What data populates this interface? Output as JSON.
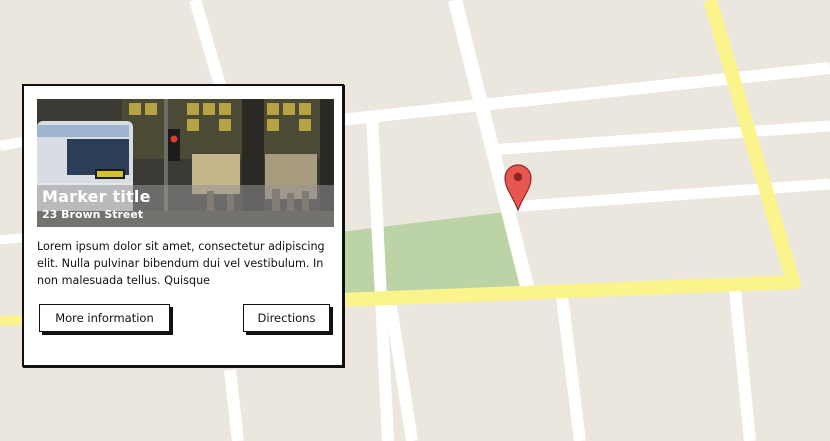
{
  "map": {
    "colors": {
      "ground": "#ebe7de",
      "street": "#ffffff",
      "major_road": "#fbf38b",
      "park": "#bcd4a5",
      "marker": "#e8574f"
    },
    "marker_icon": "map-pin-icon"
  },
  "info_window": {
    "title": "Marker title",
    "address": "23 Brown Street",
    "description": "Lorem ipsum dolor sit amet, consectetur adipiscing elit. Nulla pulvinar bibendum dui vel vestibulum. In non malesuada tellus. Quisque",
    "buttons": {
      "more_info": "More information",
      "directions": "Directions"
    }
  }
}
